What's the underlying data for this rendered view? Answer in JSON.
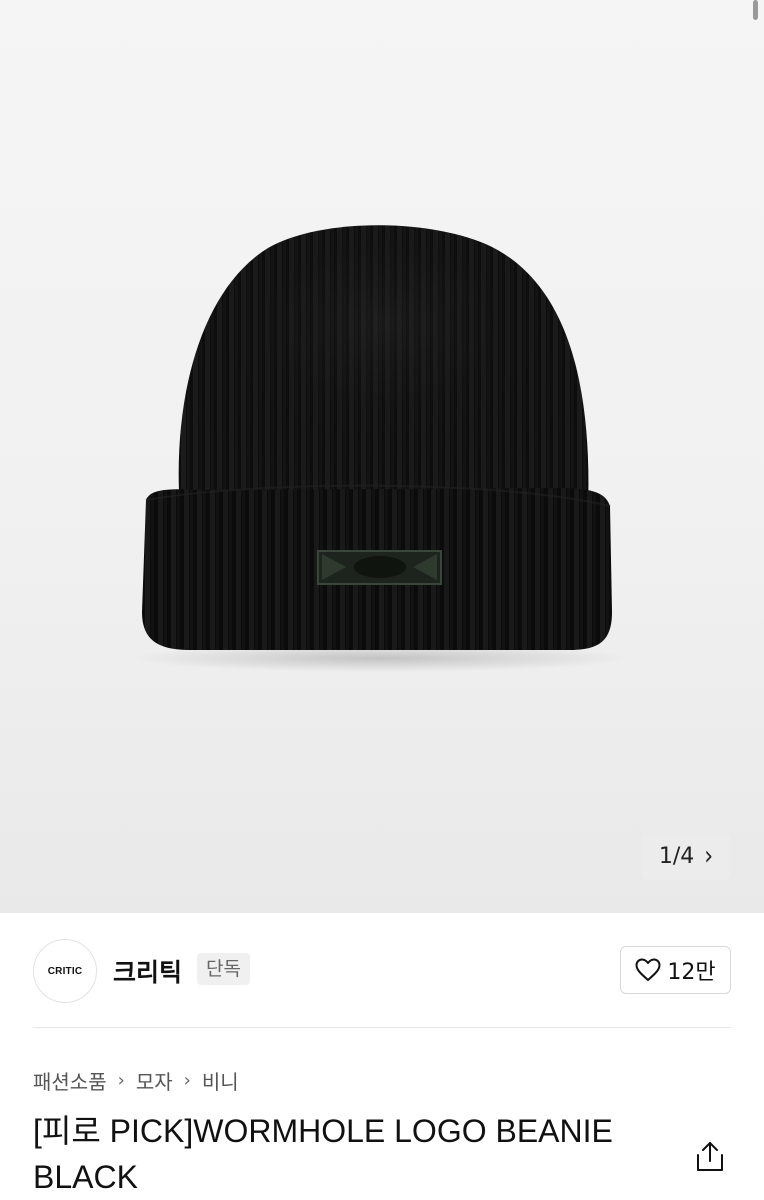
{
  "gallery": {
    "image_alt": "black ribbed knit beanie with embroidered logo",
    "counter": "1/4",
    "next_icon": "chevron-right-icon"
  },
  "brand": {
    "logo_text": "CRITIC",
    "name": "크리틱",
    "badge": "단독"
  },
  "like": {
    "icon": "heart-outline-icon",
    "count": "12만"
  },
  "breadcrumb": {
    "items": [
      "패션소품",
      "모자",
      "비니"
    ],
    "separator_icon": "chevron-right-icon"
  },
  "product": {
    "title_line1": "[피로 PICK]WORMHOLE LOGO BEANIE",
    "title_line2": "BLACK",
    "share_icon": "share-icon"
  },
  "colors": {
    "background": "#ffffff",
    "image_background": "#f2f2f2",
    "text_primary": "#111111",
    "text_secondary": "#555555",
    "badge_background": "#f0f0f0"
  }
}
